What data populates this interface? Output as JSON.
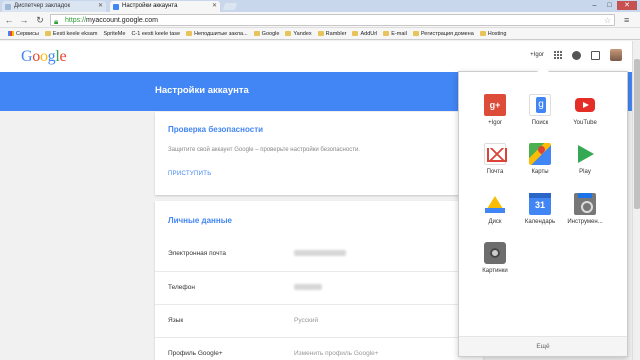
{
  "browser": {
    "tabs": [
      {
        "label": "Диспетчер закладок"
      },
      {
        "label": "Настройки аккаунта"
      }
    ],
    "url_scheme": "https://",
    "url_rest": "myaccount.google.com",
    "bookmarks": [
      {
        "label": "Сервисы",
        "icon": "apps-icon"
      },
      {
        "label": "Eesti keele eksam",
        "icon": "folder-icon"
      },
      {
        "label": "SpriteMe",
        "icon": "page-icon"
      },
      {
        "label": "C-1 eesti keele tase",
        "icon": "page-icon"
      },
      {
        "label": "Неподшитые закла...",
        "icon": "folder-icon"
      },
      {
        "label": "Google",
        "icon": "folder-icon"
      },
      {
        "label": "Yandex",
        "icon": "folder-icon"
      },
      {
        "label": "Rambler",
        "icon": "folder-icon"
      },
      {
        "label": "AddUrl",
        "icon": "folder-icon"
      },
      {
        "label": "E-mail",
        "icon": "folder-icon"
      },
      {
        "label": "Регистрация домена",
        "icon": "folder-icon"
      },
      {
        "label": "Hosting",
        "icon": "folder-icon"
      }
    ]
  },
  "header": {
    "logo": {
      "G": "G",
      "o1": "o",
      "o2": "o",
      "g": "g",
      "l": "l",
      "e": "e"
    },
    "user_name": "+Igor"
  },
  "band": {
    "title": "Настройки аккаунта"
  },
  "security_card": {
    "title": "Проверка безопасности",
    "description": "Защитите свой аккаунт Google – проверьте настройки безопасности.",
    "action": "ПРИСТУПИТЬ"
  },
  "personal_card": {
    "title": "Личные данные",
    "rows": [
      {
        "label": "Электронная почта",
        "value": ""
      },
      {
        "label": "Телефон",
        "value": ""
      },
      {
        "label": "Язык",
        "value": "Русский"
      },
      {
        "label": "Профиль Google+",
        "value": "Изменить профиль Google+"
      }
    ]
  },
  "apps_panel": {
    "apps": [
      {
        "label": "+Igor",
        "icon": "google-plus-icon",
        "glyph": "g+"
      },
      {
        "label": "Поиск",
        "icon": "google-search-icon",
        "glyph": ""
      },
      {
        "label": "YouTube",
        "icon": "youtube-icon",
        "glyph": ""
      },
      {
        "label": "Почта",
        "icon": "gmail-icon",
        "glyph": ""
      },
      {
        "label": "Карты",
        "icon": "maps-icon",
        "glyph": ""
      },
      {
        "label": "Play",
        "icon": "play-icon",
        "glyph": ""
      },
      {
        "label": "Диск",
        "icon": "drive-icon",
        "glyph": ""
      },
      {
        "label": "Календарь",
        "icon": "calendar-icon",
        "glyph": "31"
      },
      {
        "label": "Инструмен...",
        "icon": "tools-icon",
        "glyph": ""
      },
      {
        "label": "Картинки",
        "icon": "photos-icon",
        "glyph": ""
      }
    ],
    "more_label": "Ещё"
  }
}
